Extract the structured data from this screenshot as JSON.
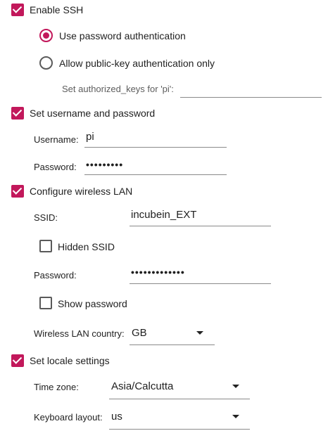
{
  "ssh": {
    "enable_label": "Enable SSH",
    "enable_checked": true,
    "password_auth_label": "Use password authentication",
    "pubkey_only_label": "Allow public-key authentication only",
    "selected_auth": "password",
    "authorized_keys_label": "Set authorized_keys for 'pi':",
    "authorized_keys_value": ""
  },
  "user": {
    "set_label": "Set username and password",
    "set_checked": true,
    "username_label": "Username:",
    "username_value": "pi",
    "password_label": "Password:",
    "password_value": "•••••••••"
  },
  "wifi": {
    "configure_label": "Configure wireless LAN",
    "configure_checked": true,
    "ssid_label": "SSID:",
    "ssid_value": "incubein_EXT",
    "hidden_ssid_label": "Hidden SSID",
    "hidden_ssid_checked": false,
    "password_label": "Password:",
    "password_value": "•••••••••••••",
    "show_password_label": "Show password",
    "show_password_checked": false,
    "country_label": "Wireless LAN country:",
    "country_value": "GB"
  },
  "locale": {
    "set_label": "Set locale settings",
    "set_checked": true,
    "timezone_label": "Time zone:",
    "timezone_value": "Asia/Calcutta",
    "keyboard_label": "Keyboard layout:",
    "keyboard_value": "us"
  },
  "colors": {
    "accent": "#c2185b",
    "text": "#1f1f1f",
    "muted": "#5d5d5d",
    "underline": "#8a8a8a"
  }
}
